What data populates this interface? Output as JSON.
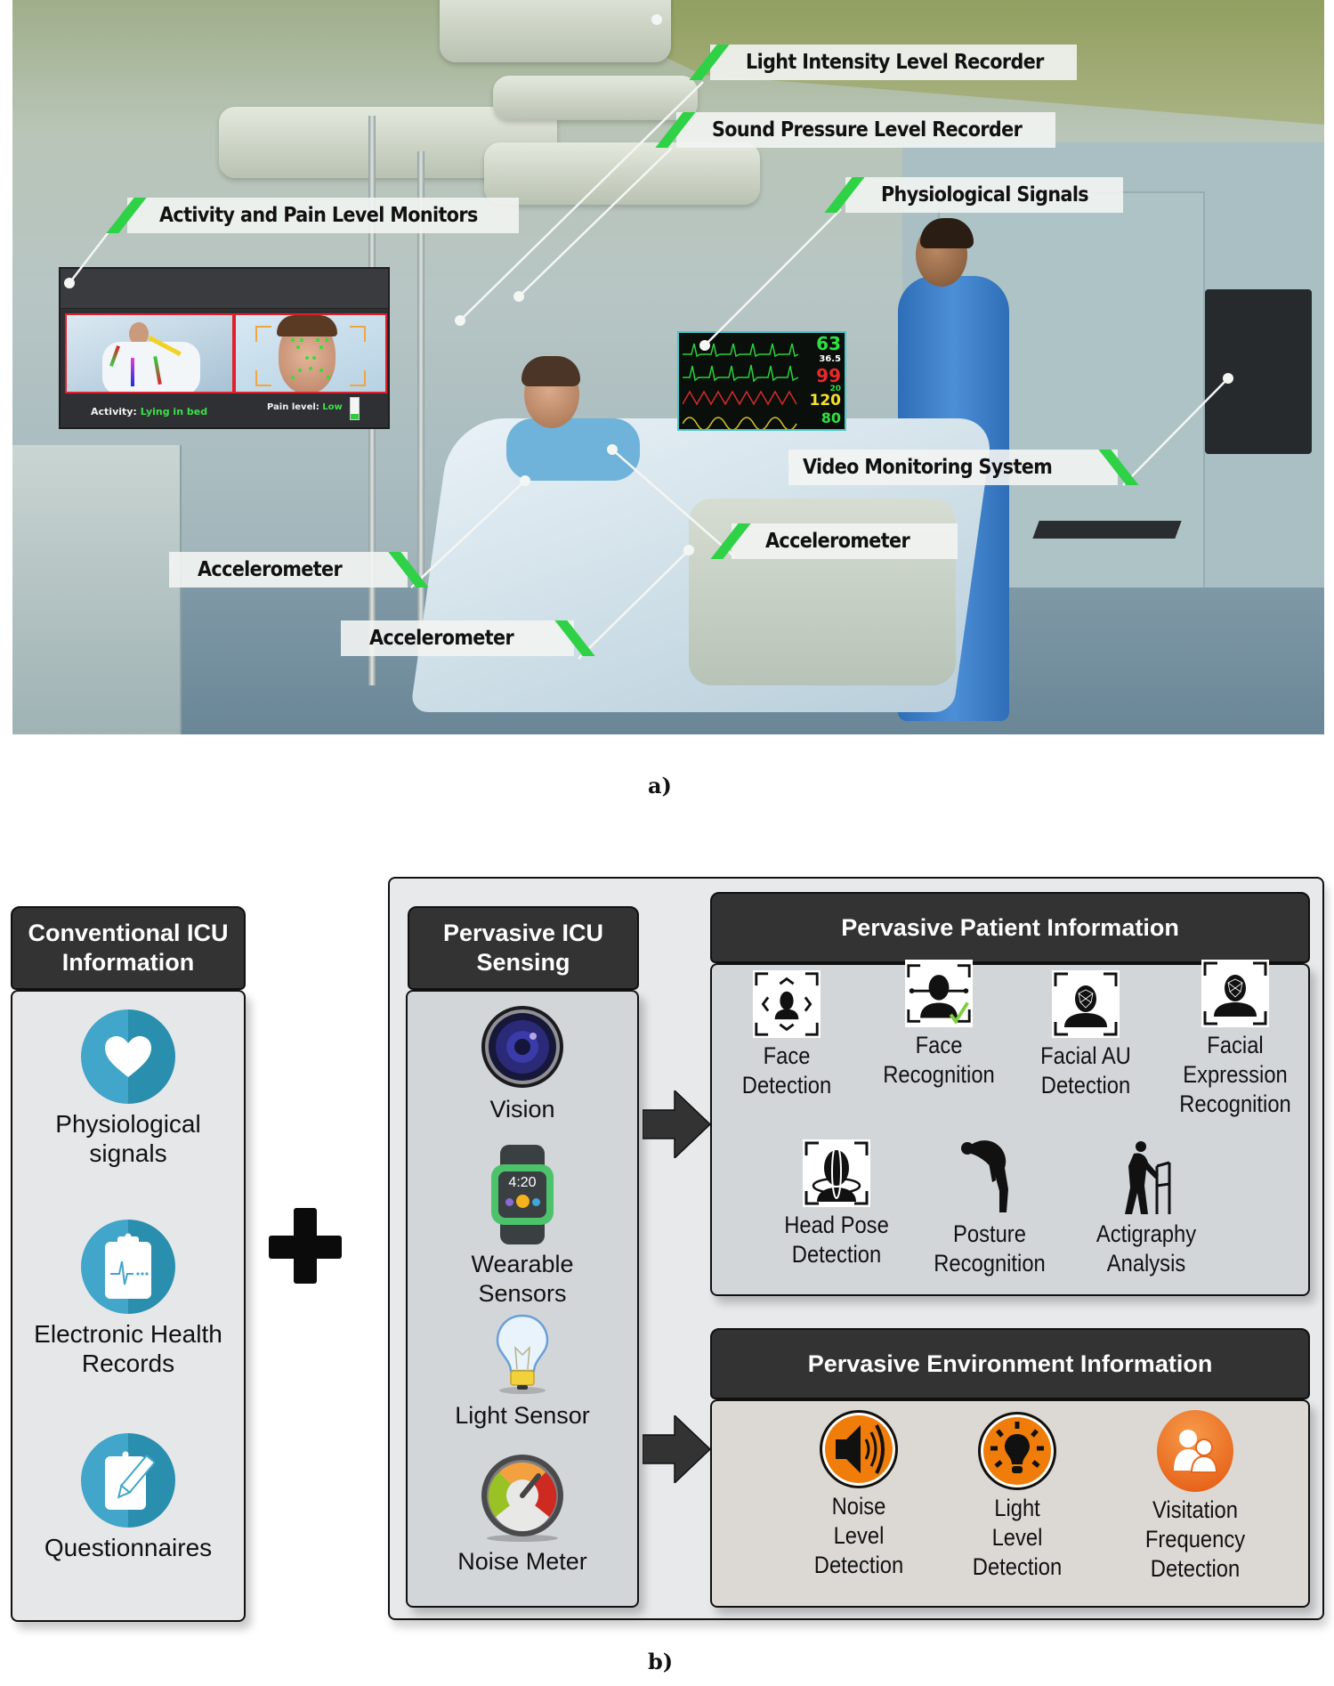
{
  "figure": {
    "panel_a_caption": "a)",
    "panel_b_caption": "b)"
  },
  "scene": {
    "callouts": [
      {
        "id": "light-intensity",
        "label": "Light Intensity Level Recorder"
      },
      {
        "id": "sound-pressure",
        "label": "Sound Pressure Level Recorder"
      },
      {
        "id": "physiological",
        "label": "Physiological Signals"
      },
      {
        "id": "activity-pain",
        "label": "Activity and Pain Level Monitors"
      },
      {
        "id": "video-monitoring",
        "label": "Video Monitoring System"
      },
      {
        "id": "accel-arm",
        "label": "Accelerometer"
      },
      {
        "id": "accel-wrist",
        "label": "Accelerometer"
      },
      {
        "id": "accel-leg",
        "label": "Accelerometer"
      }
    ],
    "activity_monitor": {
      "activity_label": "Activity:",
      "activity_value": "Lying in bed",
      "pain_label": "Pain level:",
      "pain_value": "Low",
      "pain_level_fraction": 0.25
    },
    "vitals_monitor": {
      "hr": "63",
      "temp": "36.5",
      "spo2": "99",
      "resp": "20",
      "sys": "120",
      "dia": "80"
    },
    "colors": {
      "callout_stripe": "#2fd246",
      "status_green": "#3be04a",
      "pane_border": "#e0202a"
    }
  },
  "diagram": {
    "conventional": {
      "title": "Conventional ICU Information",
      "items": [
        {
          "icon": "heart-icon",
          "label": "Physiological signals"
        },
        {
          "icon": "health-record-clipboard-icon",
          "label": "Electronic Health Records"
        },
        {
          "icon": "questionnaire-clipboard-pencil-icon",
          "label": "Questionnaires"
        }
      ]
    },
    "plus_symbol": "+",
    "sensing": {
      "title": "Pervasive ICU Sensing",
      "items": [
        {
          "icon": "camera-lens-icon",
          "label": "Vision"
        },
        {
          "icon": "smartwatch-icon",
          "label": "Wearable Sensors",
          "watch_time": "4:20"
        },
        {
          "icon": "light-bulb-icon",
          "label": "Light Sensor"
        },
        {
          "icon": "gauge-meter-icon",
          "label": "Noise Meter"
        }
      ]
    },
    "patient_info": {
      "title": "Pervasive Patient Information",
      "items": [
        {
          "icon": "face-detection-icon",
          "label": "Face Detection"
        },
        {
          "icon": "face-recognition-icon",
          "label": "Face Recognition"
        },
        {
          "icon": "facial-au-icon",
          "label": "Facial AU Detection"
        },
        {
          "icon": "facial-expression-icon",
          "label": "Facial Expression Recognition"
        },
        {
          "icon": "head-pose-icon",
          "label": "Head Pose Detection"
        },
        {
          "icon": "posture-icon",
          "label": "Posture Recognition"
        },
        {
          "icon": "actigraphy-walker-icon",
          "label": "Actigraphy Analysis"
        }
      ]
    },
    "environment_info": {
      "title": "Pervasive Environment Information",
      "items": [
        {
          "icon": "speaker-icon",
          "label": "Noise Level Detection"
        },
        {
          "icon": "light-bulb-icon",
          "label": "Light Level Detection"
        },
        {
          "icon": "visitors-icon",
          "label": "Visitation Frequency Detection"
        }
      ]
    },
    "colors": {
      "header_bg": "#333333",
      "conventional_icon": "#41a6c9",
      "environment_icon": "#f07c0a",
      "patient_body": "#d3d6d9",
      "environment_body": "#dcd9d5",
      "conventional_body": "#e6e7e9"
    }
  }
}
